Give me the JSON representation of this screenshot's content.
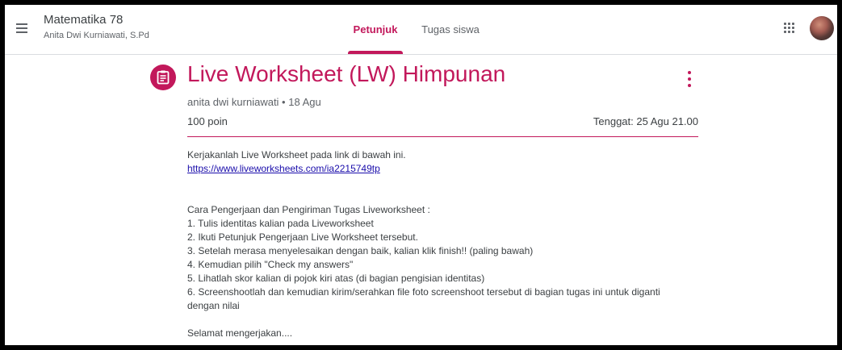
{
  "header": {
    "class_title": "Matematika 78",
    "class_teacher": "Anita Dwi Kurniawati, S.Pd",
    "tabs": [
      {
        "label": "Petunjuk",
        "active": true
      },
      {
        "label": "Tugas siswa",
        "active": false
      }
    ]
  },
  "assignment": {
    "title": "Live Worksheet (LW) Himpunan",
    "meta": "anita dwi kurniawati • 18 Agu",
    "points": "100 poin",
    "due": "Tenggat: 25 Agu 21.00",
    "intro": "Kerjakanlah Live Worksheet pada link di bawah ini.",
    "link": "https://www.liveworksheets.com/ia2215749tp",
    "steps_heading": "Cara Pengerjaan dan Pengiriman Tugas Liveworksheet :",
    "steps": [
      "1. Tulis identitas kalian pada Liveworksheet",
      "2. Ikuti Petunjuk Pengerjaan Live Worksheet tersebut.",
      "3. Setelah merasa menyelesaikan dengan baik, kalian klik finish!! (paling bawah)",
      "4. Kemudian pilih \"Check my answers\"",
      "5. Lihatlah skor kalian di pojok kiri atas (di bagian pengisian identitas)",
      "6. Screenshootlah dan kemudian kirim/serahkan file foto screenshoot tersebut di bagian tugas ini untuk diganti dengan nilai"
    ],
    "closing": "Selamat mengerjakan...."
  },
  "colors": {
    "accent": "#c2185b",
    "link": "#1a0dab",
    "text": "#3c4043",
    "muted": "#5f6368"
  },
  "icons": [
    "menu-icon",
    "assignment-icon",
    "more-vert-icon",
    "apps-grid-icon",
    "user-avatar"
  ]
}
